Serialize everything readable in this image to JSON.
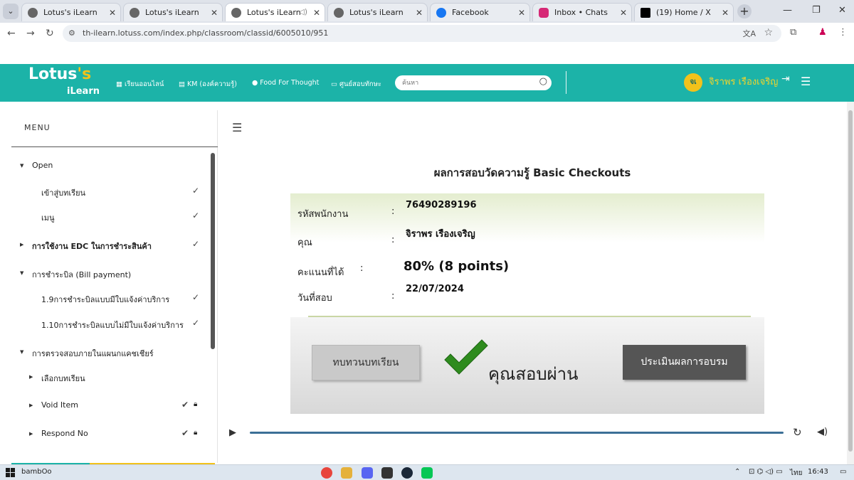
{
  "browser": {
    "tabs": [
      {
        "title": "Lotus's iLearn",
        "active": false
      },
      {
        "title": "Lotus's iLearn",
        "active": false
      },
      {
        "title": "Lotus's iLearn",
        "active": true
      },
      {
        "title": "Lotus's iLearn",
        "active": false
      },
      {
        "title": "Facebook",
        "active": false
      },
      {
        "title": "Inbox • Chats",
        "active": false
      },
      {
        "title": "(19) Home / X",
        "active": false
      }
    ],
    "url": "th-ilearn.lotuss.com/index.php/classroom/classid/6005010/951"
  },
  "header": {
    "logo_top": "Lotus",
    "logo_apos": "'s",
    "logo_bottom": "iLearn",
    "nav": [
      {
        "label": "เรียนออนไลน์",
        "icon": "grid-icon"
      },
      {
        "label": "KM (องค์ความรู้)",
        "icon": "book-icon"
      },
      {
        "label": "Food For Thought",
        "icon": "bulb-icon"
      },
      {
        "label": "ศูนย์สอบทักษะ",
        "icon": "monitor-icon"
      }
    ],
    "search_placeholder": "ค้นหา",
    "avatar_initials": "จเ",
    "user_name": "จิราพร เรืองเจริญ"
  },
  "sidebar": {
    "title": "MENU",
    "items": [
      {
        "label": "Open",
        "level": 0,
        "expanded": true,
        "check": false,
        "lock": false
      },
      {
        "label": "เข้าสู่บทเรียน",
        "level": 1,
        "check": true,
        "lock": false
      },
      {
        "label": "เมนู",
        "level": 1,
        "check": true,
        "lock": false
      },
      {
        "label": "การใช้งาน EDC ในการชำระสินค้า",
        "level": 0,
        "expanded": false,
        "check": true,
        "lock": false
      },
      {
        "label": "การชำระบิล (Bill payment)",
        "level": 0,
        "expanded": true,
        "check": false,
        "lock": false
      },
      {
        "label": "1.9การชำระบิลแบบมีใบแจ้งค่าบริการ",
        "level": 1,
        "check": true,
        "lock": false
      },
      {
        "label": "1.10การชำระบิลแบบไม่มีใบแจ้งค่าบริการ",
        "level": 1,
        "check": true,
        "lock": false
      },
      {
        "label": "การตรวจสอบภายในแผนกแคชเชียร์",
        "level": 0,
        "expanded": true,
        "check": false,
        "lock": false
      },
      {
        "label": "เลือกบทเรียน",
        "level": 1,
        "expanded": false,
        "check": false,
        "lock": false
      },
      {
        "label": "Void Item",
        "level": 1,
        "expanded": false,
        "check": true,
        "lock": true
      },
      {
        "label": "Respond No",
        "level": 1,
        "expanded": false,
        "check": true,
        "lock": true
      }
    ]
  },
  "result": {
    "title": "ผลการสอบวัดความรู้ Basic Checkouts",
    "employee_id_label": "รหัสพนักงาน",
    "employee_id": "76490289196",
    "name_label": "คุณ",
    "name": "จิราพร เรืองเจริญ",
    "score_label": "คะแนนที่ได้",
    "score": "80% (8 points)",
    "date_label": "วันที่สอบ",
    "date": "22/07/2024",
    "colon": ":",
    "review_button": "ทบทวนบทเรียน",
    "pass_text": "คุณสอบผ่าน",
    "evaluate_button": "ประเมินผลการอบรม",
    "pass_color": "#2e8b1e"
  },
  "taskbar": {
    "user": "bambOo",
    "lang": "ไทย",
    "time": "16:43"
  }
}
